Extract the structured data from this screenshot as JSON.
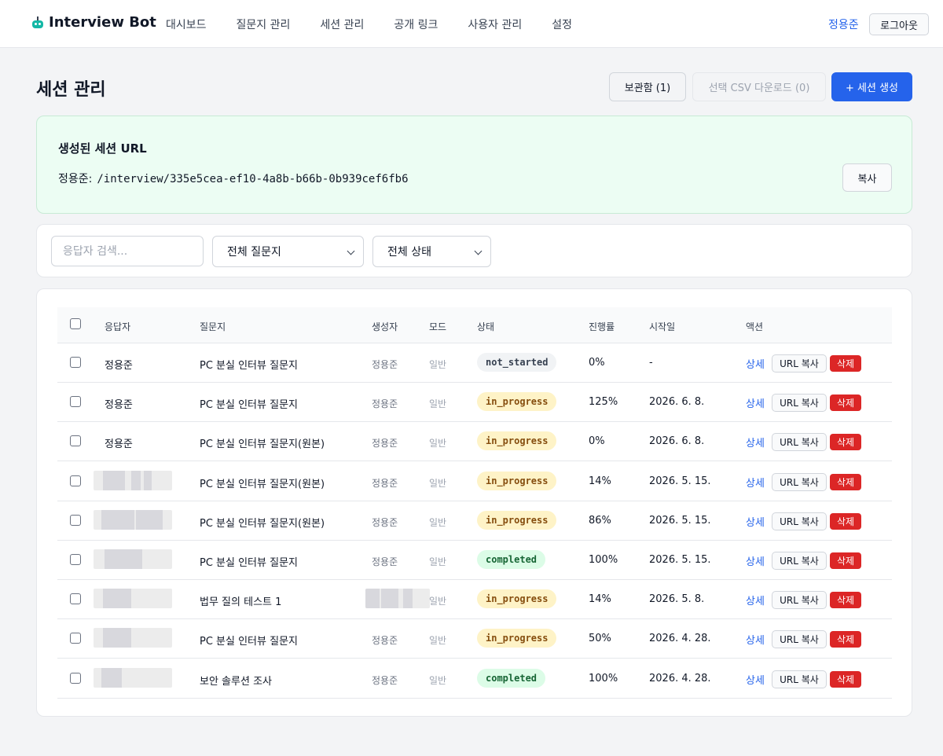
{
  "nav": {
    "brand": "Interview Bot",
    "links": [
      "대시보드",
      "질문지 관리",
      "세션 관리",
      "공개 링크",
      "사용자 관리",
      "설정"
    ],
    "user": "정용준",
    "logout": "로그아웃"
  },
  "page": {
    "title": "세션 관리",
    "archive_btn": "보관함 (1)",
    "csv_btn": "선택 CSV 다운로드 (0)",
    "create_btn": "+ 세션 생성"
  },
  "url_card": {
    "title": "생성된 세션 URL",
    "owner": "정용준:",
    "url": "/interview/335e5cea-ef10-4a8b-b66b-0b939cef6fb6",
    "copy": "복사"
  },
  "filters": {
    "search_placeholder": "응답자 검색...",
    "questionnaire": "전체 질문지",
    "status": "전체 상태"
  },
  "table": {
    "headers": [
      "응답자",
      "질문지",
      "생성자",
      "모드",
      "상태",
      "진행률",
      "시작일",
      "액션"
    ],
    "action_detail": "상세",
    "action_url": "URL 복사",
    "action_delete": "삭제",
    "rows": [
      {
        "respondent": "정용준",
        "questionnaire": "PC 분실 인터뷰 질문지",
        "creator": "정용준",
        "mode": "일반",
        "status": "not_started",
        "progress": "0%",
        "started": "-"
      },
      {
        "respondent": "정용준",
        "questionnaire": "PC 분실 인터뷰 질문지",
        "creator": "정용준",
        "mode": "일반",
        "status": "in_progress",
        "progress": "125%",
        "started": "2026. 6. 8."
      },
      {
        "respondent": "정용준",
        "questionnaire": "PC 분실 인터뷰 질문지(원본)",
        "creator": "정용준",
        "mode": "일반",
        "status": "in_progress",
        "progress": "0%",
        "started": "2026. 6. 8."
      },
      {
        "respondent": "",
        "questionnaire": "PC 분실 인터뷰 질문지(원본)",
        "creator": "정용준",
        "mode": "일반",
        "status": "in_progress",
        "progress": "14%",
        "started": "2026. 5. 15."
      },
      {
        "respondent": "",
        "questionnaire": "PC 분실 인터뷰 질문지(원본)",
        "creator": "정용준",
        "mode": "일반",
        "status": "in_progress",
        "progress": "86%",
        "started": "2026. 5. 15."
      },
      {
        "respondent": "",
        "questionnaire": "PC 분실 인터뷰 질문지",
        "creator": "정용준",
        "mode": "일반",
        "status": "completed",
        "progress": "100%",
        "started": "2026. 5. 15."
      },
      {
        "respondent": "",
        "questionnaire": "법무 질의 테스트 1",
        "creator": "",
        "mode": "일반",
        "status": "in_progress",
        "progress": "14%",
        "started": "2026. 5. 8."
      },
      {
        "respondent": "",
        "questionnaire": "PC 분실 인터뷰 질문지",
        "creator": "정용준",
        "mode": "일반",
        "status": "in_progress",
        "progress": "50%",
        "started": "2026. 4. 28."
      },
      {
        "respondent": "",
        "questionnaire": "보안 솔루션 조사",
        "creator": "정용준",
        "mode": "일반",
        "status": "completed",
        "progress": "100%",
        "started": "2026. 4. 28."
      }
    ]
  }
}
